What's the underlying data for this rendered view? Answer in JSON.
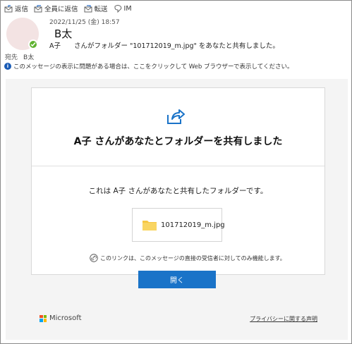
{
  "toolbar": {
    "reply": "返信",
    "reply_all": "全員に返信",
    "forward": "転送",
    "im": "IM"
  },
  "header": {
    "date": "2022/11/25 (金) 18:57",
    "sender": "B太",
    "subject": "A子　　さんがフォルダー \"101712019_m.jpg\" をあなたと共有しました。",
    "to_label": "宛先",
    "to_value": "B太",
    "info_text": "このメッセージの表示に問題がある場合は、ここをクリックして Web ブラウザーで表示してください。"
  },
  "card": {
    "title": "A子 さんがあなたとフォルダーを共有しました",
    "shared_text": "これは A子 さんがあなたと共有したフォルダーです。",
    "file_name": "101712019_m.jpg",
    "link_note": "このリンクは、このメッセージの直接の受信者に対してのみ機能します。",
    "open_button": "開く"
  },
  "footer": {
    "brand": "Microsoft",
    "privacy_link": "プライバシーに関する声明"
  },
  "colors": {
    "accent": "#1a73c8",
    "presence": "#5fb230",
    "folder": "#f6c744"
  },
  "icons": [
    "reply-icon",
    "reply-all-icon",
    "forward-icon",
    "im-icon",
    "check-icon",
    "info-icon",
    "share-icon",
    "folder-icon",
    "link-icon",
    "microsoft-logo"
  ]
}
